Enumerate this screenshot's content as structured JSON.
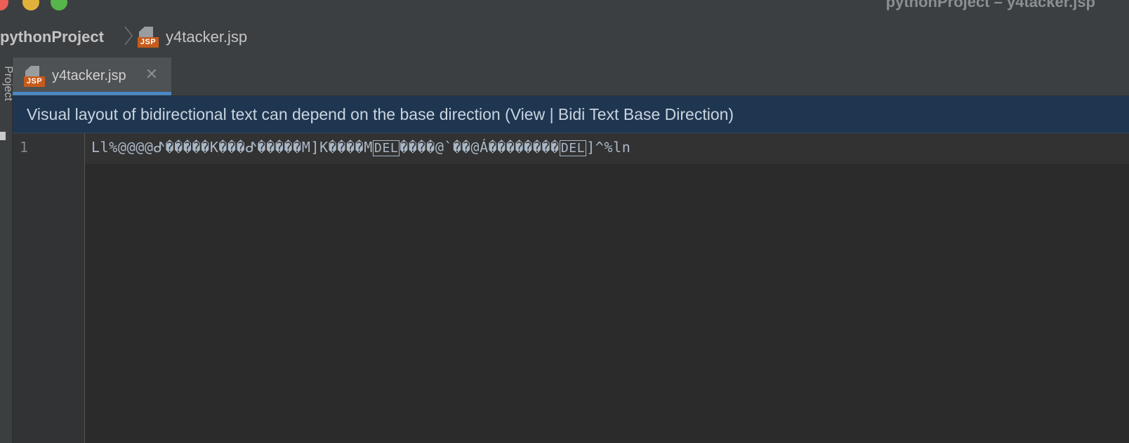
{
  "window": {
    "title": "pythonProject – y4tacker.jsp"
  },
  "breadcrumb": {
    "project": "pythonProject",
    "file": "y4tacker.jsp"
  },
  "file_icon": {
    "badge": "JSP",
    "color": "#c75b1c"
  },
  "toolstrip": {
    "project_label": "Project"
  },
  "tabs": [
    {
      "label": "y4tacker.jsp",
      "close_icon": "close-icon"
    }
  ],
  "banner": {
    "text": "Visual layout of bidirectional text can depend on the base direction (View | Bidi Text Base Direction)"
  },
  "editor": {
    "line_numbers": [
      "1"
    ],
    "line1_segments": [
      "Ll%@@@@ᕷ�����K���ᕷ�����M]K����M",
      "DEL",
      "����@`��@Á��������",
      "DEL",
      "]^%ln"
    ]
  },
  "colors": {
    "accent": "#4a88c7",
    "banner_bg": "#1f3651",
    "editor_bg": "#2b2b2b"
  }
}
